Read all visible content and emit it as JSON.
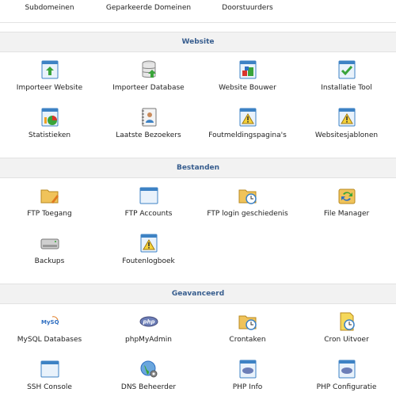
{
  "top_row": [
    "Subdomeinen",
    "Geparkeerde Domeinen",
    "Doorstuurders"
  ],
  "sections": {
    "website": {
      "title": "Website",
      "items": [
        "Importeer Website",
        "Importeer Database",
        "Website Bouwer",
        "Installatie Tool",
        "Statistieken",
        "Laatste Bezoekers",
        "Foutmeldingspagina's",
        "Websitesjablonen"
      ]
    },
    "files": {
      "title": "Bestanden",
      "items": [
        "FTP Toegang",
        "FTP Accounts",
        "FTP login geschiedenis",
        "File Manager",
        "Backups",
        "Foutenlogboek"
      ]
    },
    "advanced": {
      "title": "Geavanceerd",
      "items": [
        "MySQL Databases",
        "phpMyAdmin",
        "Crontaken",
        "Cron Uitvoer",
        "SSH Console",
        "DNS Beheerder",
        "PHP Info",
        "PHP Configuratie"
      ],
      "mysql_logo_text": "MySQL",
      "php_logo_text": "php"
    }
  },
  "icons": {
    "importeer-website": "upload-arrow-window-icon",
    "importeer-database": "database-icon",
    "website-bouwer": "blocks-icon",
    "installatie-tool": "checkmark-window-icon",
    "statistieken": "chart-icon",
    "laatste-bezoekers": "visitor-notebook-icon",
    "foutmeldingspaginas": "warning-window-icon",
    "websitesjablonen": "warning-window-icon",
    "ftp-toegang": "folder-pencil-icon",
    "ftp-accounts": "window-icon",
    "ftp-login-geschiedenis": "folder-clock-icon",
    "file-manager": "recycle-arrows-icon",
    "backups": "drive-icon",
    "foutenlogboek": "warning-window-icon",
    "mysql-databases": "mysql-logo-icon",
    "phpmyadmin": "php-logo-icon",
    "crontaken": "folder-clock-icon",
    "cron-uitvoer": "note-clock-icon",
    "ssh-console": "window-icon",
    "dns-beheerder": "globe-gear-icon",
    "php-info": "php-window-icon",
    "php-configuratie": "php-window-icon"
  },
  "colors": {
    "header_text": "#375d8e",
    "header_bg": "#f2f2f2",
    "window_blue": "#3d82c4",
    "folder_yellow": "#f0c35a",
    "warning_yellow": "#f5d23a",
    "check_green": "#3aa43a"
  }
}
